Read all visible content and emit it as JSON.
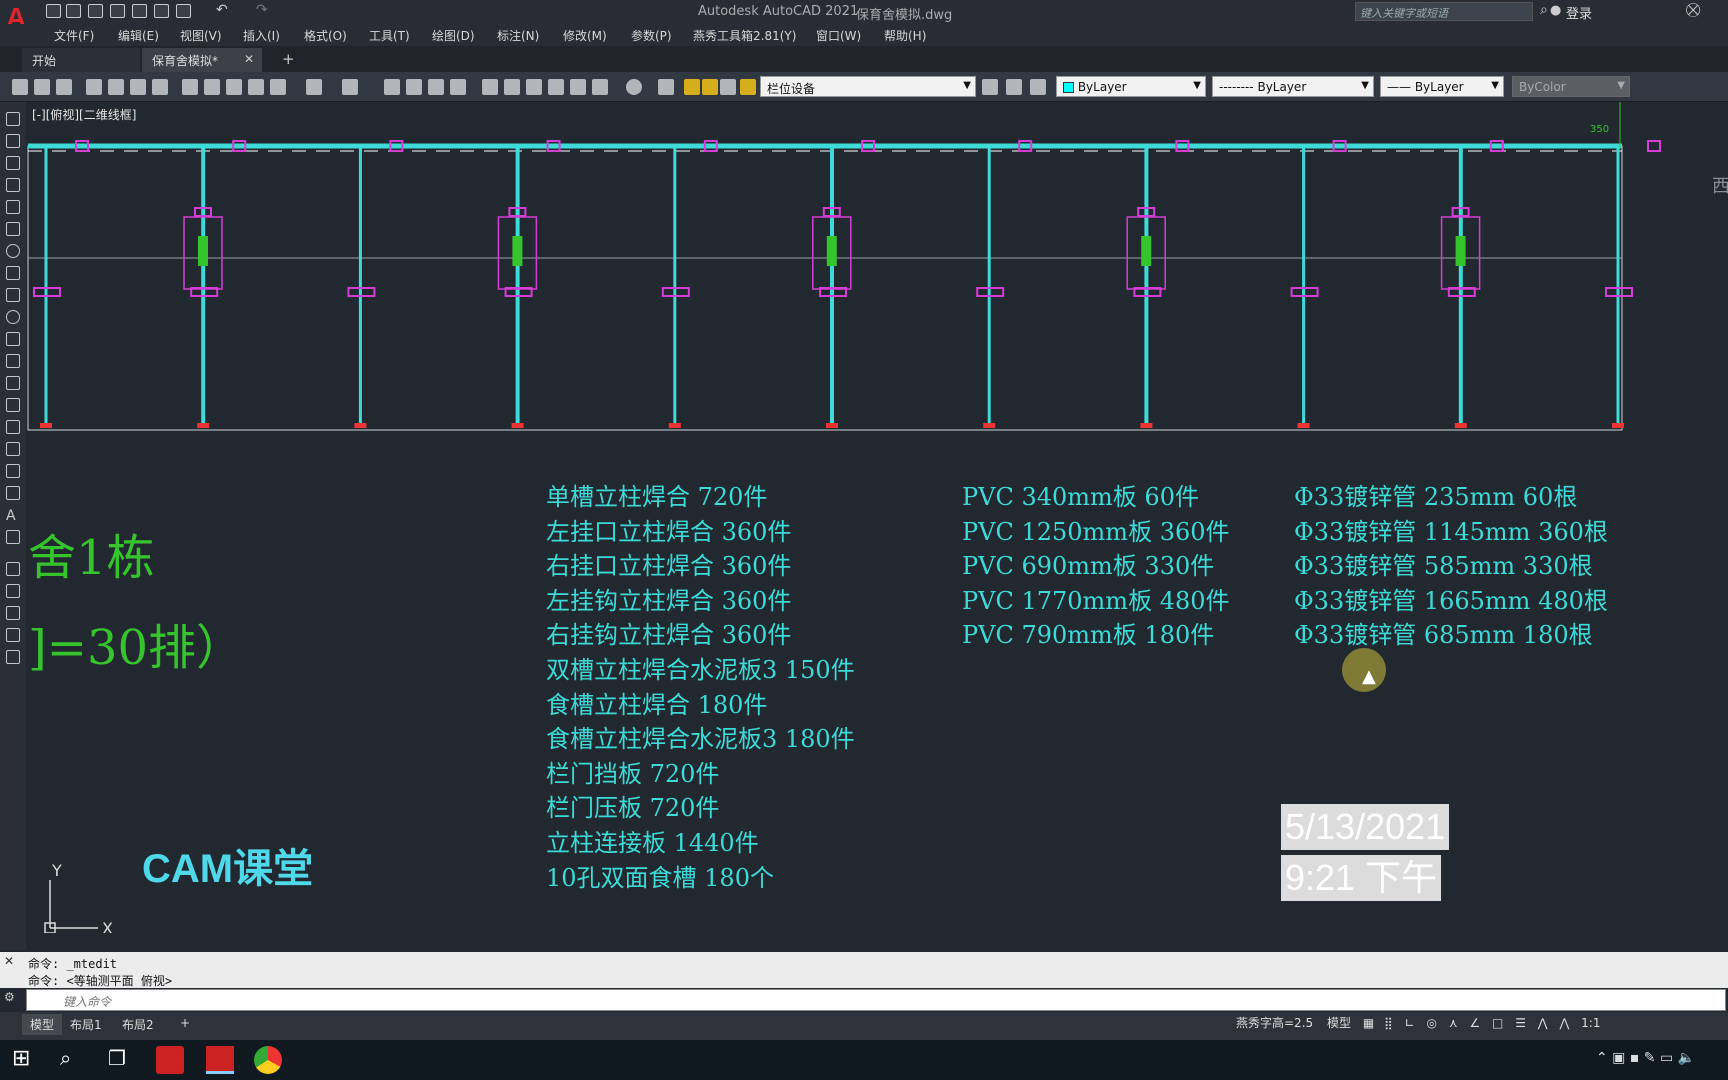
{
  "app": {
    "title": "Autodesk AutoCAD 2021",
    "doc": "保育舍模拟.dwg",
    "logo": "A",
    "search_placeholder": "键入关键字或短语",
    "login": "登录"
  },
  "menus": [
    "文件(F)",
    "编辑(E)",
    "视图(V)",
    "插入(I)",
    "格式(O)",
    "工具(T)",
    "绘图(D)",
    "标注(N)",
    "修改(M)",
    "参数(P)",
    "燕秀工具箱2.81(Y)",
    "窗口(W)",
    "帮助(H)"
  ],
  "tabs": {
    "start": "开始",
    "doc": "保育舍模拟*",
    "close": "✕",
    "add": "+"
  },
  "toolbar": {
    "layer": "栏位设备",
    "color": "ByLayer",
    "linetype": "-------- ByLayer",
    "lineweight": "—— ByLayer",
    "plotstyle": "ByColor"
  },
  "view_label": "[-][俯视][二维线框]",
  "dimension": "350",
  "titles": {
    "line1": "舍1栋",
    "line2": "]=30排）"
  },
  "list1": [
    "单槽立柱焊合 720件",
    "左挂口立柱焊合 360件",
    "右挂口立柱焊合 360件",
    "左挂钩立柱焊合 360件",
    "右挂钩立柱焊合 360件",
    "双槽立柱焊合水泥板3 150件",
    "食槽立柱焊合 180件",
    "食槽立柱焊合水泥板3 180件",
    "栏门挡板 720件",
    "栏门压板 720件",
    "立柱连接板 1440件",
    "10孔双面食槽 180个"
  ],
  "list2": [
    "PVC 340mm板 60件",
    "PVC 1250mm板 360件",
    "PVC 690mm板 330件",
    "PVC 1770mm板 480件",
    "PVC 790mm板 180件"
  ],
  "list3": [
    "Φ33镀锌管 235mm 60根",
    "Φ33镀锌管 1145mm 360根",
    "Φ33镀锌管 585mm 330根",
    "Φ33镀锌管 1665mm 480根",
    "Φ33镀锌管 685mm 180根"
  ],
  "watermark": "CAM课堂",
  "datetime": {
    "date": "5/13/2021",
    "time": "9:21 下午"
  },
  "compass": "西",
  "ucs": {
    "x": "X",
    "y": "Y"
  },
  "cmd": {
    "h1": "命令: _mtedit",
    "h2": "命令: <等轴测平面 俯视>",
    "placeholder": "键入命令"
  },
  "layout_tabs": [
    "模型",
    "布局1",
    "布局2"
  ],
  "status": {
    "text": "燕秀字高=2.5",
    "model": "模型",
    "scale": "1:1"
  },
  "colors": {
    "cyan": "#3ddad7",
    "green": "#36c42d",
    "magenta": "#d63dd6",
    "bg": "#212830"
  }
}
